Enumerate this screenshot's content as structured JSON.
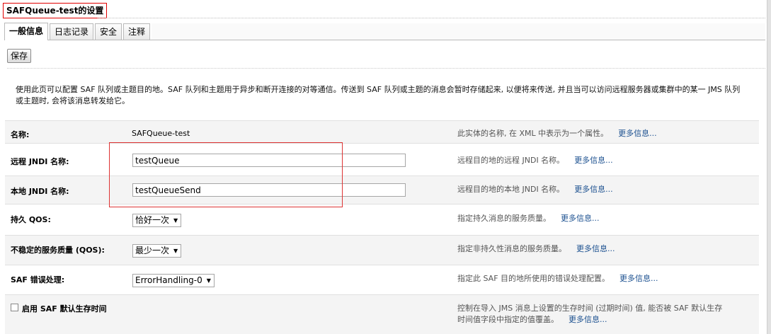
{
  "page": {
    "title": "SAFQueue-test的设置",
    "tabs": [
      "一般信息",
      "日志记录",
      "安全",
      "注释"
    ],
    "save_label": "保存",
    "description": "使用此页可以配置 SAF 队列或主题目的地。SAF 队列和主题用于异步和断开连接的对等通信。传送到 SAF 队列或主题的消息会暂时存储起来, 以便将来传送, 并且当可以访问远程服务器或集群中的某一 JMS 队列或主题时, 会将该消息转发给它。"
  },
  "fields": {
    "more_info": "更多信息...",
    "name": {
      "label": "名称:",
      "value": "SAFQueue-test",
      "help": "此实体的名称, 在 XML 中表示为一个属性。"
    },
    "remote_jndi": {
      "label": "远程 JNDI 名称:",
      "value": "testQueue",
      "help": "远程目的地的远程 JNDI 名称。"
    },
    "local_jndi": {
      "label": "本地 JNDI 名称:",
      "value": "testQueueSend",
      "help": "远程目的地的本地 JNDI 名称。"
    },
    "persistent_qos": {
      "label": "持久 QOS:",
      "value": "恰好一次",
      "help": "指定持久消息的服务质量。"
    },
    "nonpersistent_qos": {
      "label": "不稳定的服务质量 (QOS):",
      "value": "最少一次",
      "help": "指定非持久性消息的服务质量。"
    },
    "error_handling": {
      "label": "SAF 错误处理:",
      "value": "ErrorHandling-0",
      "help": "指定此 SAF 目的地所使用的错误处理配置。"
    },
    "saf_ttl": {
      "label": "启用 SAF 默认生存时间",
      "help_line1": "控制在导入 JMS 消息上设置的生存时间 (过期时间) 值, 能否被 SAF 默认生存",
      "help_line2": "时间值字段中指定的值覆盖。"
    }
  },
  "colors": {
    "highlight_box": "#dd3333",
    "link": "#1a4f8f",
    "alt_row": "#f4f4f4"
  }
}
